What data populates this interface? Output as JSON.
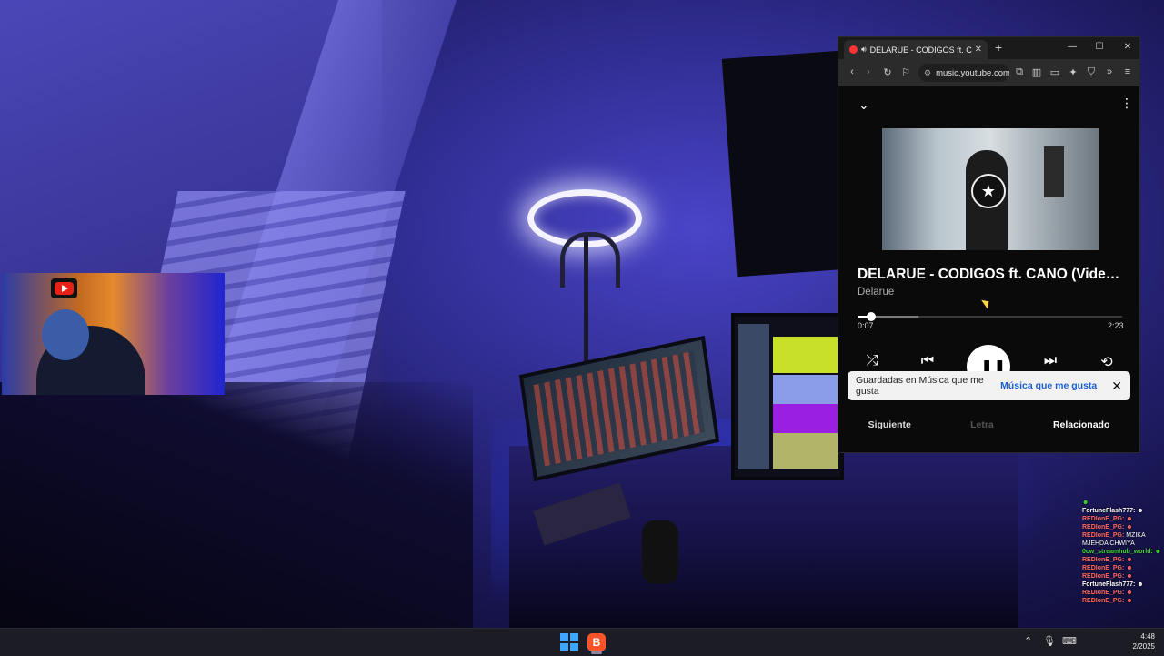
{
  "browser": {
    "tab_title": "DELARUE - CODIGOS ft. CANO",
    "url": "music.youtube.com",
    "new_tab_symbol": "+",
    "tab_close_symbol": "✕"
  },
  "player": {
    "song_title": "DELARUE - CODIGOS ft. CANO (Video ...",
    "artist": "Delarue",
    "current_time": "0:07",
    "total_time": "2:23",
    "progress_fraction": 0.05,
    "buffered_fraction": 0.23
  },
  "toast": {
    "message": "Guardadas en Música que me gusta",
    "link": "Música que me gusta"
  },
  "bottom_tabs": [
    {
      "label": "Siguiente",
      "state": "active"
    },
    {
      "label": "Letra",
      "state": "disabled"
    },
    {
      "label": "Relacionado",
      "state": "normal"
    }
  ],
  "chat": [
    {
      "user": "",
      "text": "",
      "user_color": "#3ddc2f"
    },
    {
      "user": "FortuneFlash777:",
      "text": "",
      "user_color": "#ffffff"
    },
    {
      "user": "REDIonE_PG:",
      "text": "",
      "user_color": "#ff6a6a"
    },
    {
      "user": "REDIonE_PG:",
      "text": "",
      "user_color": "#ff6a6a"
    },
    {
      "user": "REDIonE_PG:",
      "text": "MZIKA MJEHDA CHWIYA",
      "user_color": "#ff6a6a"
    },
    {
      "user": "0cw_streamhub_world:",
      "text": "",
      "user_color": "#3ddc2f"
    },
    {
      "user": "REDIonE_PG:",
      "text": "",
      "user_color": "#ff6a6a"
    },
    {
      "user": "REDIonE_PG:",
      "text": "",
      "user_color": "#ff6a6a"
    },
    {
      "user": "REDIonE_PG:",
      "text": "",
      "user_color": "#ff6a6a"
    },
    {
      "user": "FortuneFlash777:",
      "text": "",
      "user_color": "#ffffff"
    },
    {
      "user": "REDIonE_PG:",
      "text": "",
      "user_color": "#ff6a6a"
    },
    {
      "user": "REDIonE_PG:",
      "text": "",
      "user_color": "#ff6a6a"
    }
  ],
  "taskbar": {
    "time": "4:48",
    "date": "2/2025"
  },
  "colors": {
    "accent_link": "#1a5fd0",
    "yt_red": "#e62117",
    "brave_orange": "#fb542b",
    "win_blue": "#3ea6ff"
  }
}
